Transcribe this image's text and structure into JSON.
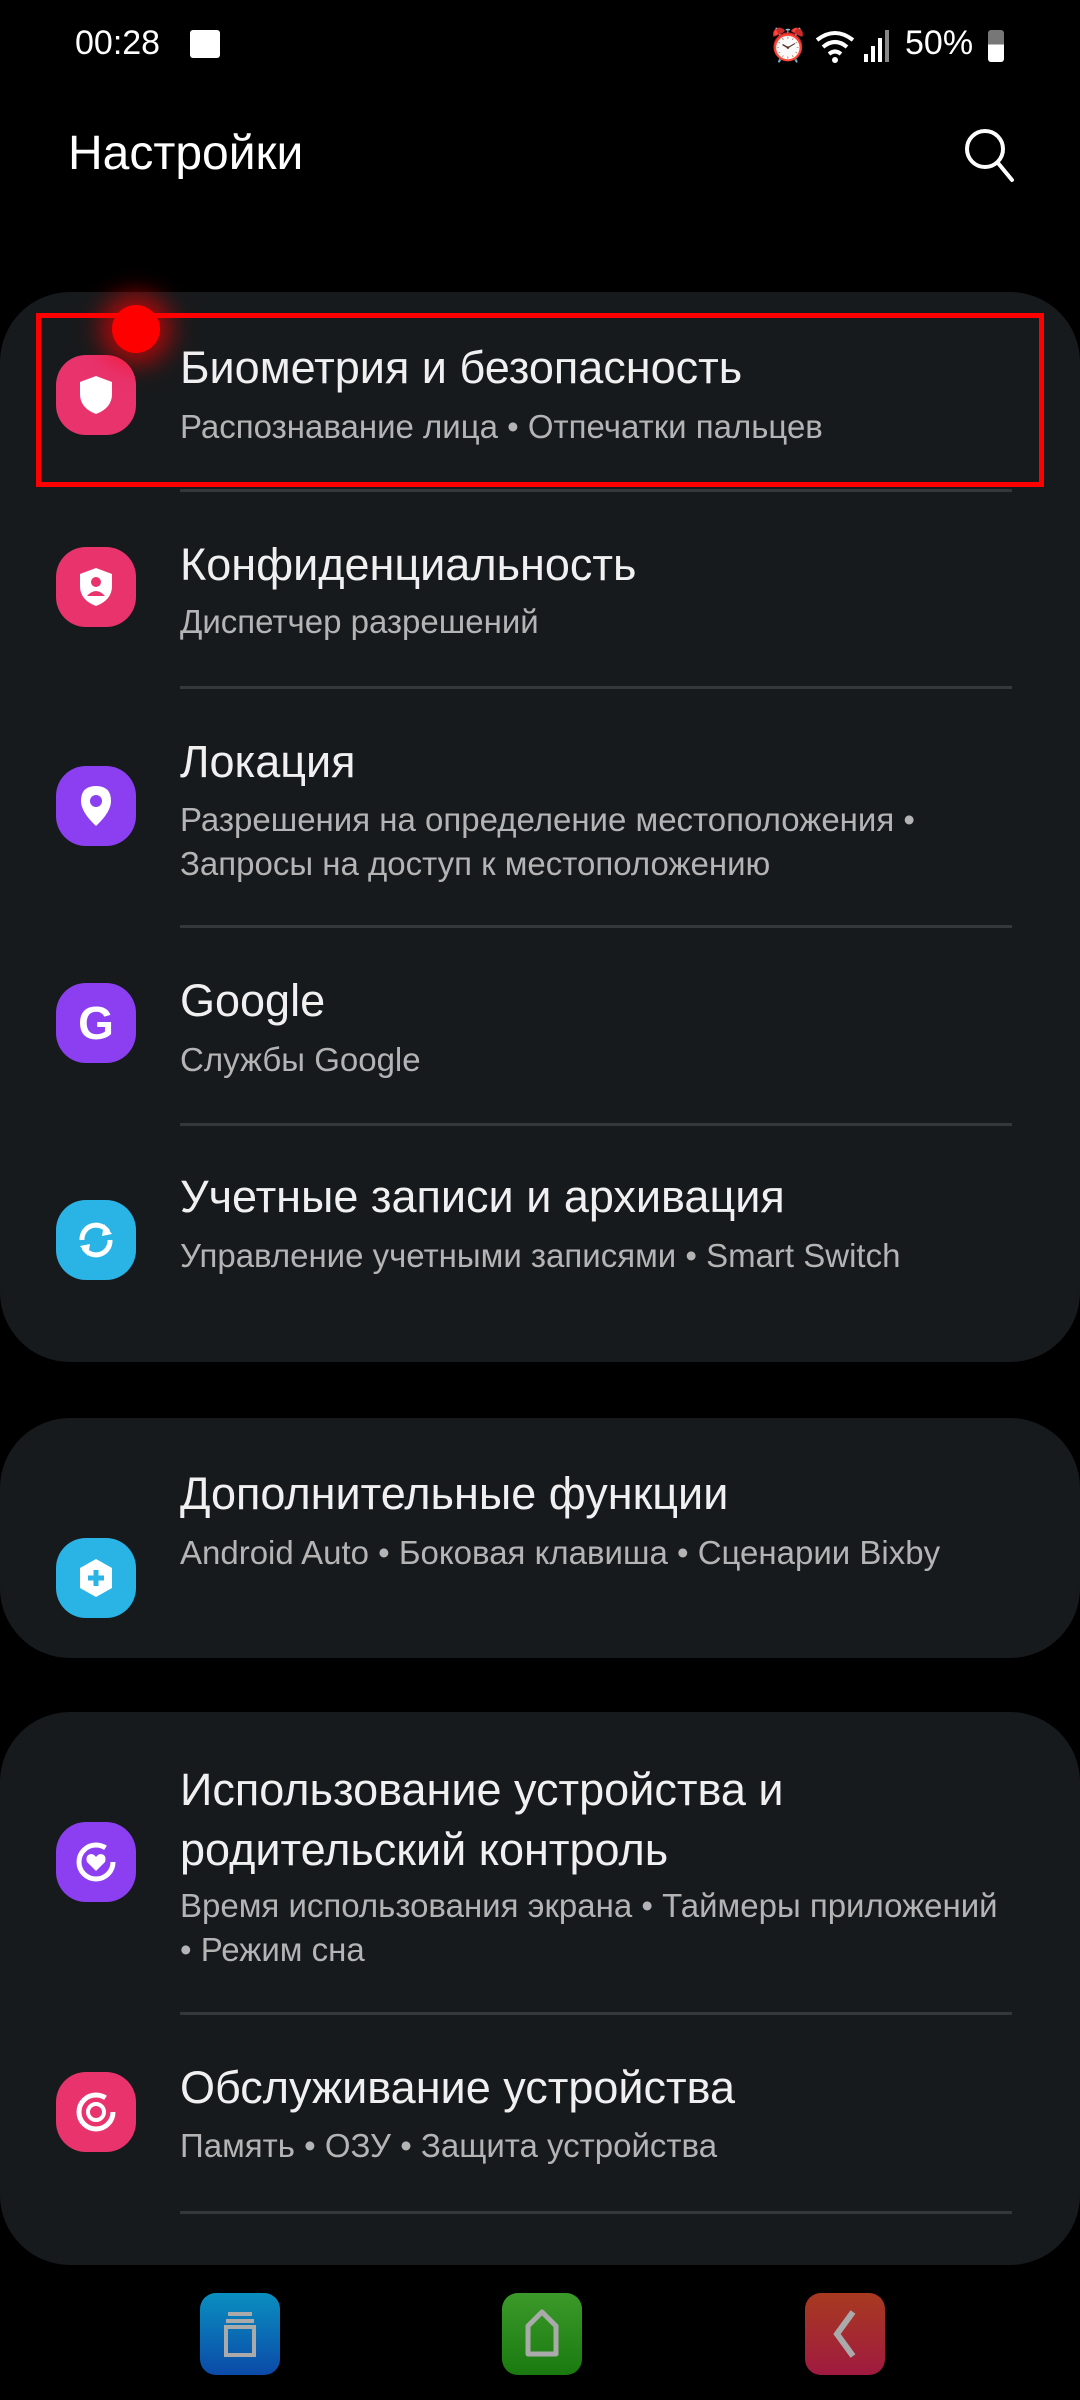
{
  "status_bar": {
    "time": "00:28",
    "battery": "50%"
  },
  "header": {
    "title": "Настройки"
  },
  "groups": [
    {
      "items": [
        {
          "title": "Биометрия и безопасность",
          "subtitle": "Распознавание лица  •  Отпечатки пальцев",
          "icon": "shield-icon",
          "color": "#e8336d",
          "highlighted": true
        },
        {
          "title": "Конфиденциальность",
          "subtitle": "Диспетчер разрешений",
          "icon": "privacy-shield-icon",
          "color": "#e8336d"
        },
        {
          "title": "Локация",
          "subtitle": "Разрешения на определение местоположения  •  Запросы на доступ к местоположению",
          "icon": "location-pin-icon",
          "color": "#8b3ff0"
        },
        {
          "title": "Google",
          "subtitle": "Службы Google",
          "icon": "google-icon",
          "color": "#8b3ff0"
        },
        {
          "title": "Учетные записи и архивация",
          "subtitle": "Управление учетными записями  •  Smart Switch",
          "icon": "sync-icon",
          "color": "#2ab4e6"
        }
      ]
    },
    {
      "items": [
        {
          "title": "Дополнительные функции",
          "subtitle": "Android Auto  •  Боковая клавиша  •  Сценарии Bixby",
          "icon": "puzzle-plus-icon",
          "color": "#2ab4e6"
        }
      ]
    },
    {
      "items": [
        {
          "title": "Использование устройства и родительский контроль",
          "subtitle": "Время использования экрана  •  Таймеры приложений  •  Режим сна",
          "icon": "heart-circle-icon",
          "color": "#8b3ff0"
        },
        {
          "title": "Обслуживание устройства",
          "subtitle": "Память  •  ОЗУ  •  Защита устройства",
          "icon": "device-care-icon",
          "color": "#e8336d"
        }
      ]
    }
  ],
  "nav_bar": {
    "colors": {
      "recents": "#0a72c4",
      "home": "#2a8f1e",
      "back": "#b02a3a"
    }
  }
}
